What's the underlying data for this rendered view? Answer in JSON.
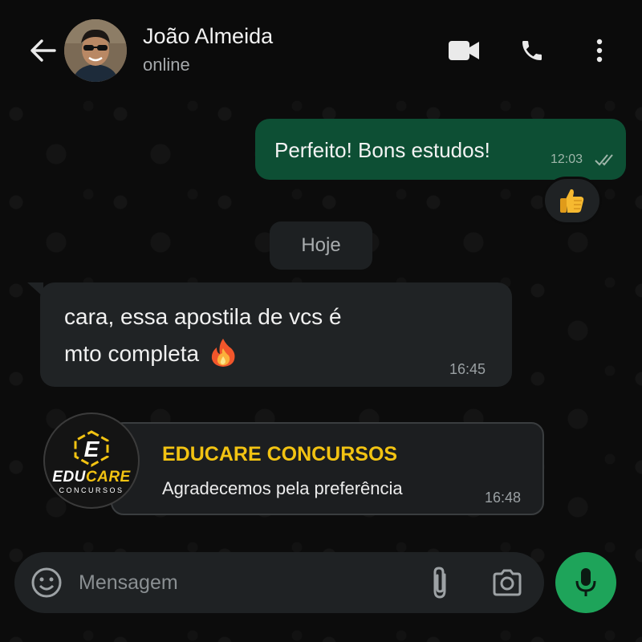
{
  "header": {
    "contact_name": "João Almeida",
    "status": "online",
    "icons": [
      "back-arrow-icon",
      "video-call-icon",
      "phone-icon",
      "more-vert-icon"
    ]
  },
  "messages": {
    "outgoing": {
      "text": "Perfeito! Bons estudos!",
      "time": "12:03",
      "status_icon": "double-check-icon",
      "reaction": "👍"
    },
    "date_separator": "Hoje",
    "incoming": {
      "line1": "cara, essa apostila de vcs é",
      "line2": "mto completa",
      "emoji": "🔥",
      "time": "16:45"
    },
    "business_card": {
      "title": "EDUCARE CONCURSOS",
      "subtitle": "Agradecemos pela preferência",
      "time": "16:48",
      "logo_word_white": "EDU",
      "logo_word_yellow": "CARE",
      "logo_sub": "CONCURSOS",
      "logo_letter": "E"
    }
  },
  "composer": {
    "placeholder": "Mensagem",
    "value": ""
  },
  "colors": {
    "accent_green": "#1ea45a",
    "outgoing_bubble": "#0d4f34",
    "brand_yellow": "#f2c312"
  }
}
